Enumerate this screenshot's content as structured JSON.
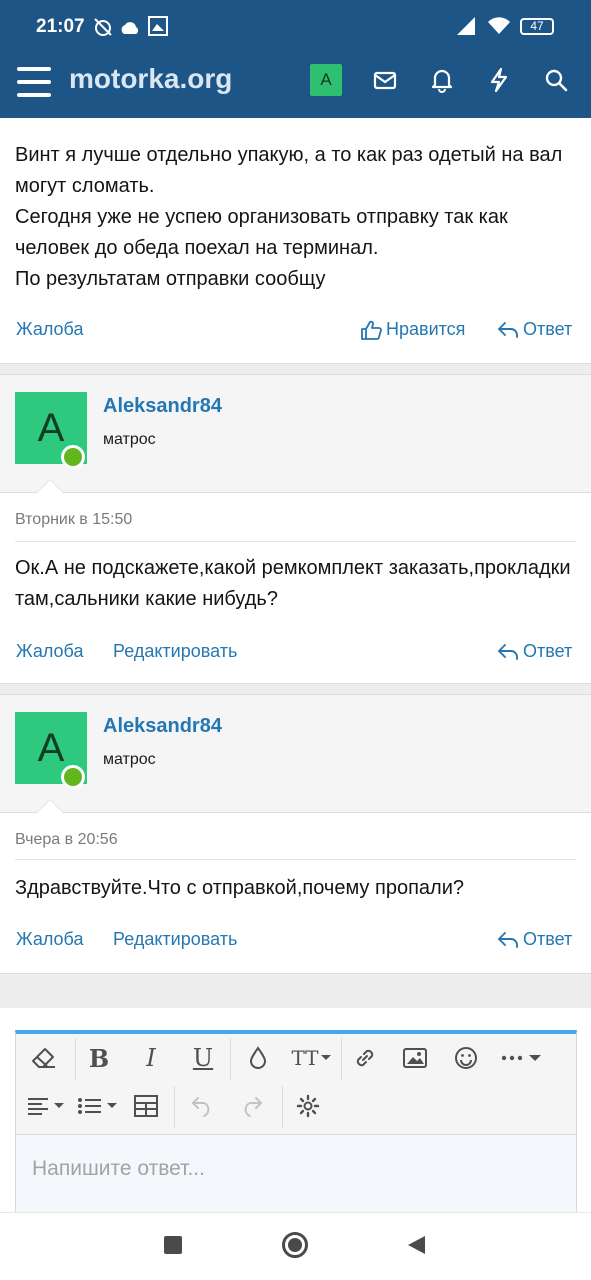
{
  "status": {
    "time": "21:07",
    "battery": "47"
  },
  "header": {
    "site_title": "motorka.org",
    "avatar_letter": "A"
  },
  "posts": [
    {
      "lines": [
        "Винт я лучше отдельно упакую, а то как раз одетый на вал могут сломать.",
        "Сегодня уже не успею организовать отправку так как человек до обеда поехал на терминал.",
        "По результатам отправки сообщу"
      ],
      "report": "Жалоба",
      "like": "Нравится",
      "reply": "Ответ"
    },
    {
      "avatar_letter": "A",
      "username": "Aleksandr84",
      "user_title": "матрос",
      "date": "Вторник в 15:50",
      "text": "Ок.А не подскажете,какой ремкомплект заказать,прокладки там,сальники какие нибудь?",
      "report": "Жалоба",
      "edit": "Редактировать",
      "reply": "Ответ"
    },
    {
      "avatar_letter": "A",
      "username": "Aleksandr84",
      "user_title": "матрос",
      "date": "Вчера в 20:56",
      "text": "Здравствуйте.Что с отправкой,почему пропали?",
      "report": "Жалоба",
      "edit": "Редактировать",
      "reply": "Ответ"
    }
  ],
  "editor": {
    "placeholder": "Напишите ответ...",
    "bold": "B",
    "italic": "I",
    "underline": "U",
    "text_size": "TT"
  },
  "colors": {
    "header_bg": "#1d5587",
    "link": "#2577b1",
    "avatar_bg": "#2ec97f",
    "online": "#63b61f",
    "editor_accent": "#47a7eb"
  }
}
